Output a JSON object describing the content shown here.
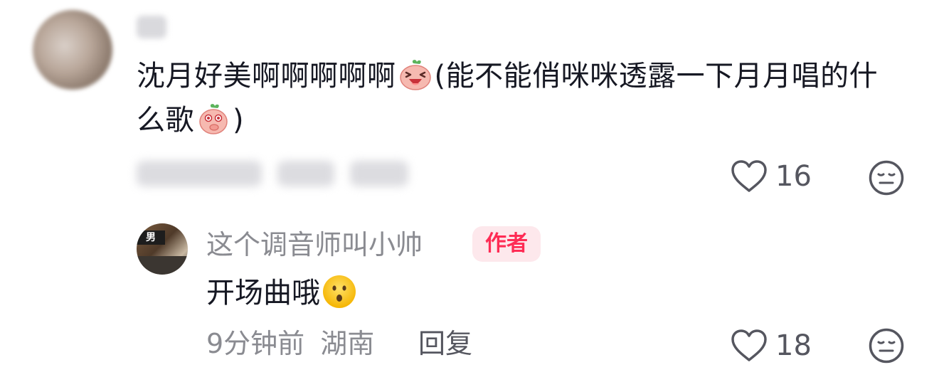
{
  "comment": {
    "username": "",
    "text_part1": "沈月好美啊啊啊啊啊",
    "emoji1": "laughing-peach-emoji",
    "text_part2": "(能不能俏咪咪透露一下月月唱的什么歌",
    "emoji2": "thinking-peach-emoji",
    "text_part3": ")",
    "like_count": "16"
  },
  "reply": {
    "author": "这个调音师叫小帅",
    "badge": "作者",
    "text": "开场曲哦",
    "emoji": "hushed-face-emoji",
    "time": "9分钟前",
    "location": "湖南",
    "reply_label": "回复",
    "like_count": "18"
  },
  "colors": {
    "text": "#161823",
    "muted": "#8a8b91",
    "badge_bg": "#fde8ec",
    "badge_text": "#fe2c55"
  }
}
